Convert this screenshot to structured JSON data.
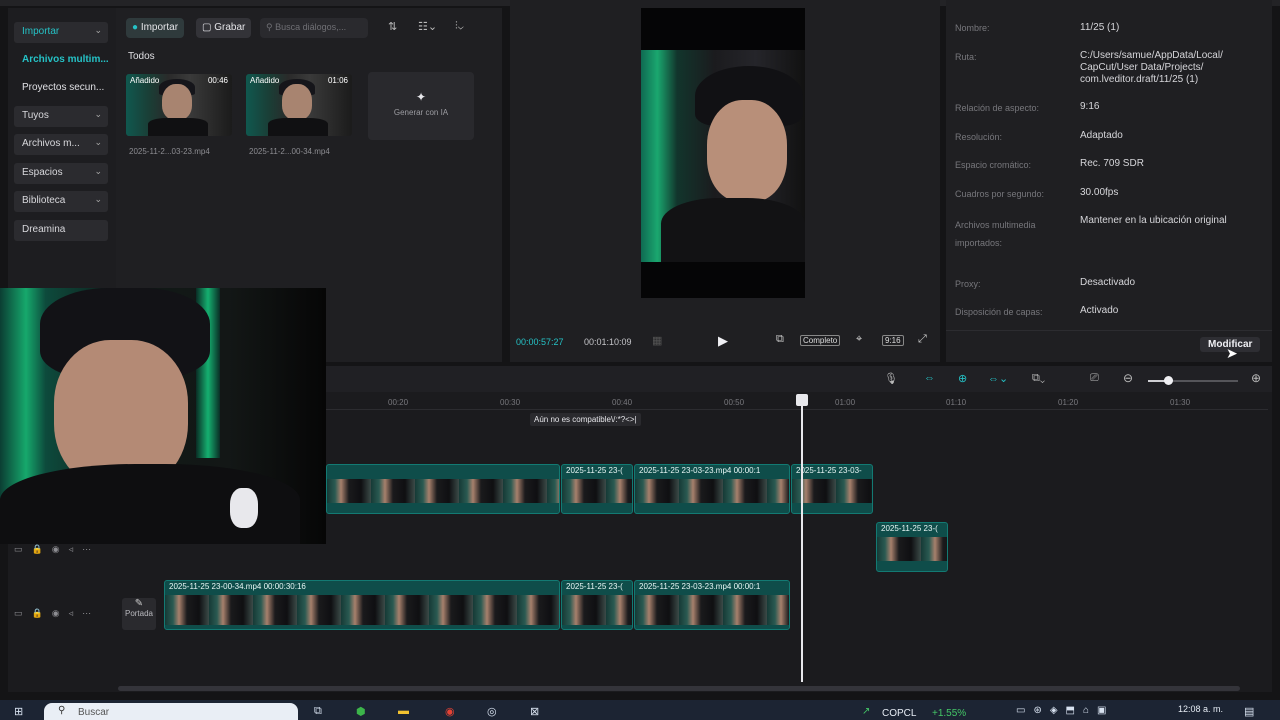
{
  "media_panel": {
    "sidebar": [
      {
        "label": "Importar",
        "active": true,
        "chevron": true
      },
      {
        "label": "Archivos multim...",
        "active": true,
        "plain": true
      },
      {
        "label": "Proyectos secun...",
        "plain": true
      },
      {
        "label": "Tuyos",
        "chevron": true
      },
      {
        "label": "Archivos m...",
        "chevron": true
      },
      {
        "label": "Espacios",
        "chevron": true
      },
      {
        "label": "Biblioteca",
        "chevron": true
      },
      {
        "label": "Dreamina"
      }
    ],
    "toolbar": {
      "import_label": "Importar",
      "record_label": "Grabar",
      "search_placeholder": "Busca diálogos,..."
    },
    "filter_label": "Todos",
    "thumbnails": [
      {
        "tag": "Añadido",
        "duration": "00:46",
        "name": "2025-11-2...03-23.mp4"
      },
      {
        "tag": "Añadido",
        "duration": "01:06",
        "name": "2025-11-2...00-34.mp4"
      }
    ],
    "ai_generate_label": "Generar con IA"
  },
  "player": {
    "current_time": "00:00:57:27",
    "total_time": "00:01:10:09",
    "complete_label": "Completo",
    "ratio_label": "9:16"
  },
  "properties": {
    "rows": [
      {
        "label": "Nombre:",
        "value": "11/25 (1)"
      },
      {
        "label": "Ruta:",
        "value": "C:/Users/samue/AppData/Local/ CapCut/User Data/Projects/ com.lveditor.draft/11/25 (1)"
      },
      {
        "label": "Relación de aspecto:",
        "value": "9:16"
      },
      {
        "label": "Resolución:",
        "value": "Adaptado"
      },
      {
        "label": "Espacio cromático:",
        "value": "Rec. 709 SDR"
      },
      {
        "label": "Cuadros por segundo:",
        "value": "30.00fps"
      },
      {
        "label": "Archivos multimedia importados:",
        "value": "Mantener en la ubicación original"
      },
      {
        "label": "Proxy:",
        "value": "Desactivado"
      },
      {
        "label": "Disposición de capas:",
        "value": "Activado"
      }
    ],
    "modify_label": "Modificar"
  },
  "timeline": {
    "ruler_ticks": [
      "00:20",
      "00:30",
      "00:40",
      "00:50",
      "01:00",
      "01:10",
      "01:20",
      "01:30"
    ],
    "tooltip": "Aún no es compatible\\/:*?<>|",
    "cover_label": "Portada",
    "track1_clips": [
      {
        "label": ""
      },
      {
        "label": "2025-11-25 23-("
      },
      {
        "label": "2025-11-25 23-03-23.mp4   00:00:1"
      },
      {
        "label": "2025-11-25 23-03-"
      }
    ],
    "track2_clips": [
      {
        "label": "2025-11-25 23-("
      }
    ],
    "main_clips": [
      {
        "label": "2025-11-25 23-00-34.mp4   00:00:30:16"
      },
      {
        "label": "2025-11-25 23-("
      },
      {
        "label": "2025-11-25 23-03-23.mp4   00:00:1"
      }
    ]
  },
  "taskbar": {
    "search_placeholder": "Buscar",
    "ticker_label": "COPCL",
    "ticker_change": "+1.55%",
    "time": "12:08 a. m."
  },
  "colors": {
    "accent": "#25c2c6",
    "panel": "#1f1f22",
    "clip": "#0f4d4a"
  }
}
